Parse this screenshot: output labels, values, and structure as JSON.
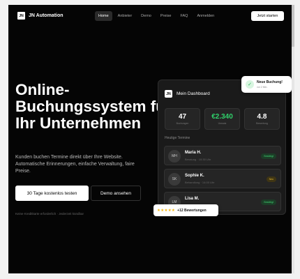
{
  "nav": {
    "logo_mark": "JN",
    "brand": "JN Automation",
    "links": [
      "Home",
      "Anbieter",
      "Demo",
      "Preise",
      "FAQ",
      "Anmelden"
    ],
    "cta": "Jetzt starten"
  },
  "hero": {
    "title": "Online-Buchungssystem für Ihr Unternehmen",
    "subtitle": "Kunden buchen Termine direkt über Ihre Website. Automatische Erinnerungen, einfache Verwaltung, faire Preise.",
    "primary_button": "30 Tage kostenlos testen",
    "secondary_button": "Demo ansehen",
    "note": "Keine Kreditkarte erforderlich · Jederzeit kündbar"
  },
  "dashboard": {
    "logo_mark": "JN",
    "title": "Mein Dashboard",
    "stats": [
      {
        "value": "47",
        "label": "Buchungen"
      },
      {
        "value": "€2.340",
        "label": "Umsatz"
      },
      {
        "value": "4.8",
        "label": "Bewertung"
      }
    ],
    "section_label": "Heutige Termine",
    "appointments": [
      {
        "initials": "MH",
        "name": "Maria H.",
        "time": "Beratung · 10:30 Uhr",
        "status": "Bestätigt"
      },
      {
        "initials": "SK",
        "name": "Sophie K.",
        "time": "Behandlung · 14:00 Uhr",
        "status": "Neu"
      },
      {
        "initials": "LM",
        "name": "Lisa M.",
        "time": "Termin · 16:30 Uhr",
        "status": "Bestätigt"
      }
    ]
  },
  "toast": {
    "icon": "check-icon",
    "title": "Neue Buchung!",
    "subtitle": "vor 2 Min."
  },
  "rating": {
    "stars": "★★★★★",
    "text": "+12 Bewertungen"
  },
  "colors": {
    "background": "#050505",
    "accent_green": "#2fd06a",
    "badge_yellow": "#e5b82c",
    "star": "#f5b50a"
  }
}
